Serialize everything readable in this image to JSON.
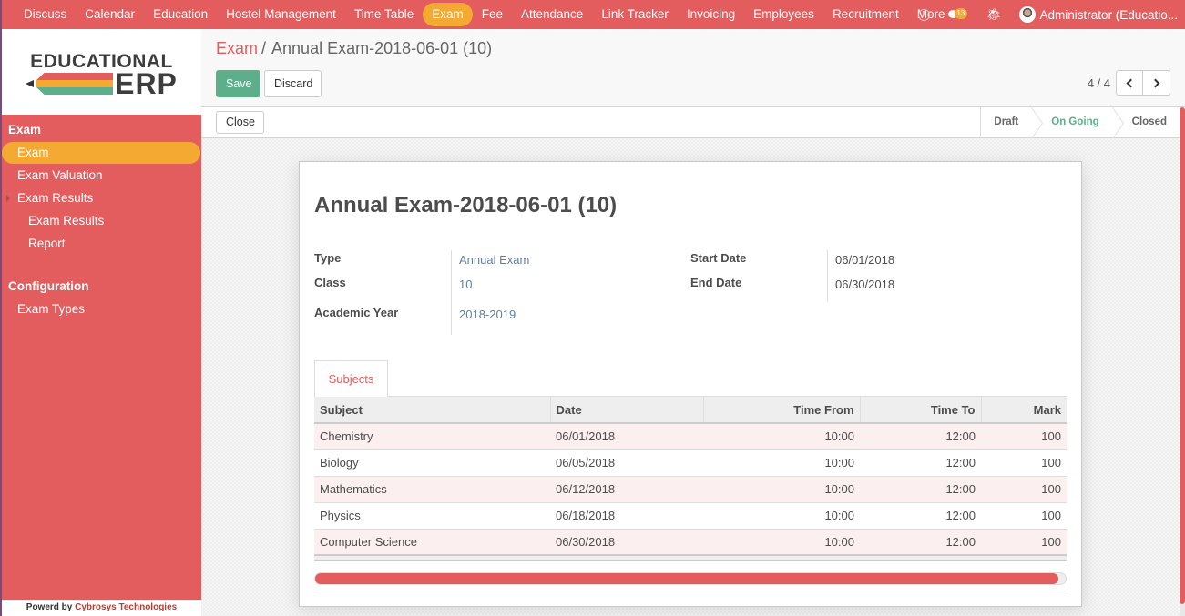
{
  "navbar": {
    "menu": [
      {
        "label": "Discuss"
      },
      {
        "label": "Calendar"
      },
      {
        "label": "Education"
      },
      {
        "label": "Hostel Management"
      },
      {
        "label": "Time Table"
      },
      {
        "label": "Exam",
        "active": true
      },
      {
        "label": "Fee"
      },
      {
        "label": "Attendance"
      },
      {
        "label": "Link Tracker"
      },
      {
        "label": "Invoicing"
      },
      {
        "label": "Employees"
      },
      {
        "label": "Recruitment"
      }
    ],
    "more_label": "More",
    "icons": {
      "activity": "clock-icon",
      "messages": "chat-icon",
      "debug": "bug-icon"
    },
    "message_count": "13",
    "user_name": "Administrator (Educatio..."
  },
  "sidebar": {
    "logo": {
      "line1": "EDUCATIONAL",
      "line2": "ERP"
    },
    "sections": [
      {
        "title": "Exam",
        "items": [
          {
            "label": "Exam",
            "active": true
          },
          {
            "label": "Exam Valuation"
          },
          {
            "label": "Exam Results",
            "expandable": true
          },
          {
            "label": "Exam Results",
            "sub": true
          },
          {
            "label": "Report",
            "sub": true
          }
        ]
      },
      {
        "title": "Configuration",
        "items": [
          {
            "label": "Exam Types"
          }
        ]
      }
    ],
    "footer": {
      "prefix": "Powerd by",
      "brand": "Cybrosys Technologies"
    }
  },
  "control_panel": {
    "breadcrumb_parent": "Exam",
    "breadcrumb_separator": "/",
    "breadcrumb_current": "Annual Exam-2018-06-01 (10)",
    "save_label": "Save",
    "discard_label": "Discard",
    "pager_value": "4 / 4"
  },
  "statusbar": {
    "close_label": "Close",
    "steps": [
      {
        "label": "Draft"
      },
      {
        "label": "On Going",
        "current": true
      },
      {
        "label": "Closed"
      }
    ]
  },
  "form": {
    "title": "Annual Exam-2018-06-01 (10)",
    "left_fields": [
      {
        "label": "Type",
        "value": "Annual Exam"
      },
      {
        "label": "Class",
        "value": "10"
      },
      {
        "label": "Academic Year",
        "value": "2018-2019"
      }
    ],
    "right_fields": [
      {
        "label": "Start Date",
        "value": "06/01/2018"
      },
      {
        "label": "End Date",
        "value": "06/30/2018"
      }
    ],
    "tabs": [
      {
        "label": "Subjects"
      }
    ],
    "table": {
      "columns": [
        "Subject",
        "Date",
        "Time From",
        "Time To",
        "Mark"
      ],
      "rows": [
        [
          "Chemistry",
          "06/01/2018",
          "10:00",
          "12:00",
          "100"
        ],
        [
          "Biology",
          "06/05/2018",
          "10:00",
          "12:00",
          "100"
        ],
        [
          "Mathematics",
          "06/12/2018",
          "10:00",
          "12:00",
          "100"
        ],
        [
          "Physics",
          "06/18/2018",
          "10:00",
          "12:00",
          "100"
        ],
        [
          "Computer Science",
          "06/30/2018",
          "10:00",
          "12:00",
          "100"
        ]
      ]
    },
    "horizontal_scroll_fraction": 0.99
  },
  "colors": {
    "primary": "#e35d5f",
    "accent": "#f4a932",
    "success": "#5dae8b",
    "link": "#5e7fa8"
  }
}
